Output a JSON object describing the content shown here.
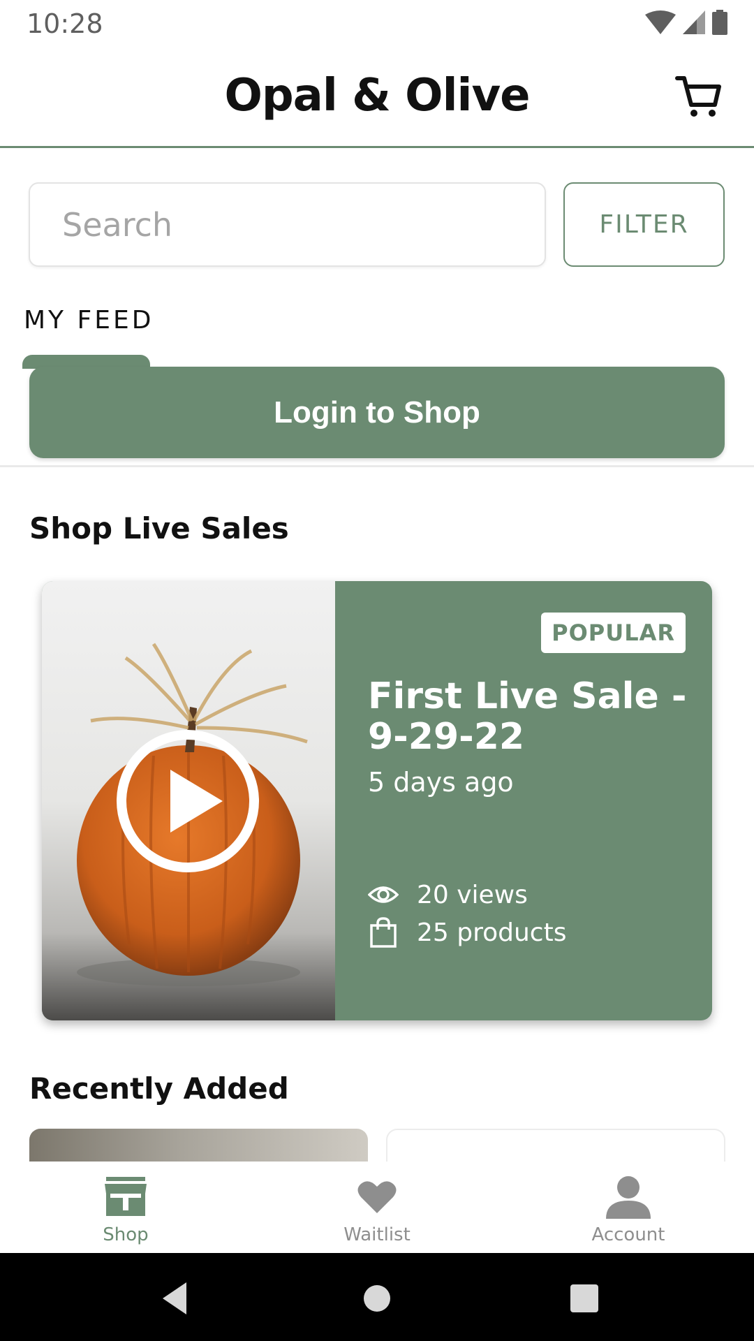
{
  "status_bar": {
    "time": "10:28"
  },
  "header": {
    "title": "Opal & Olive"
  },
  "search": {
    "placeholder": "Search",
    "filter_label": "FILTER"
  },
  "feed": {
    "tab_label": "MY FEED",
    "login_label": "Login to Shop"
  },
  "live_sales": {
    "section_title": "Shop Live Sales",
    "cards": [
      {
        "badge": "POPULAR",
        "title": "First Live Sale - 9-29-22",
        "time": "5 days ago",
        "views": "20 views",
        "products": "25 products"
      }
    ]
  },
  "recently_added": {
    "section_title": "Recently Added"
  },
  "bottom_nav": {
    "items": [
      {
        "label": "Shop",
        "icon": "storefront-icon",
        "active": true
      },
      {
        "label": "Waitlist",
        "icon": "heart-icon",
        "active": false
      },
      {
        "label": "Account",
        "icon": "person-icon",
        "active": false
      }
    ]
  },
  "colors": {
    "accent": "#6b8b72",
    "text": "#111111",
    "muted": "#8e8e8e"
  }
}
